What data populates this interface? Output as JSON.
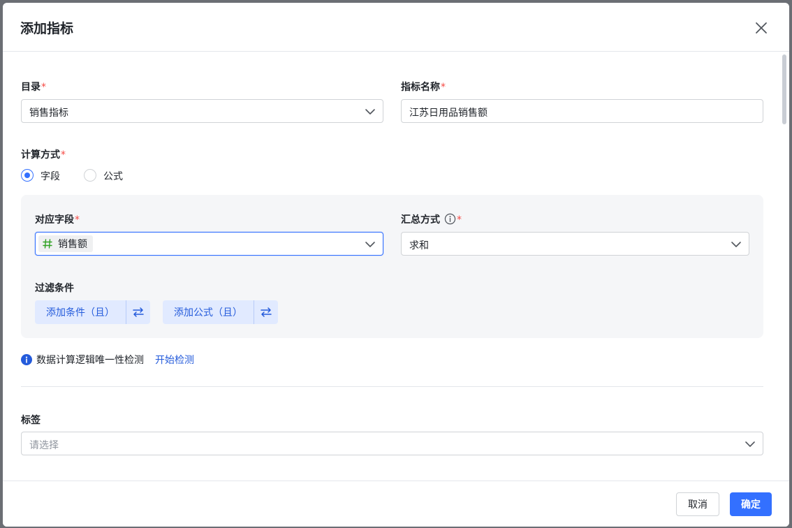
{
  "dialog": {
    "title": "添加指标"
  },
  "catalog": {
    "label": "目录",
    "required_mark": "*",
    "value": "销售指标"
  },
  "metric_name": {
    "label": "指标名称",
    "required_mark": "*",
    "value": "江苏日用品销售额"
  },
  "calc_method": {
    "label": "计算方式",
    "required_mark": "*",
    "options": [
      {
        "label": "字段",
        "checked": true
      },
      {
        "label": "公式",
        "checked": false
      }
    ]
  },
  "field_panel": {
    "field_label": "对应字段",
    "field_required_mark": "*",
    "field_tag": "销售额",
    "agg_label": "汇总方式",
    "agg_required_mark": "*",
    "agg_value": "求和",
    "filter_label": "过滤条件",
    "add_condition": "添加条件（且）",
    "add_formula": "添加公式（且）"
  },
  "check": {
    "text": "数据计算逻辑唯一性检测",
    "link": "开始检测"
  },
  "tags": {
    "label": "标签",
    "placeholder": "请选择"
  },
  "footer": {
    "cancel": "取消",
    "ok": "确定"
  },
  "colors": {
    "primary": "#3370ff",
    "required": "#f54a45",
    "link": "#245bdb",
    "panel_bg": "#f5f6f8",
    "tag_hash": "#2ea121"
  }
}
